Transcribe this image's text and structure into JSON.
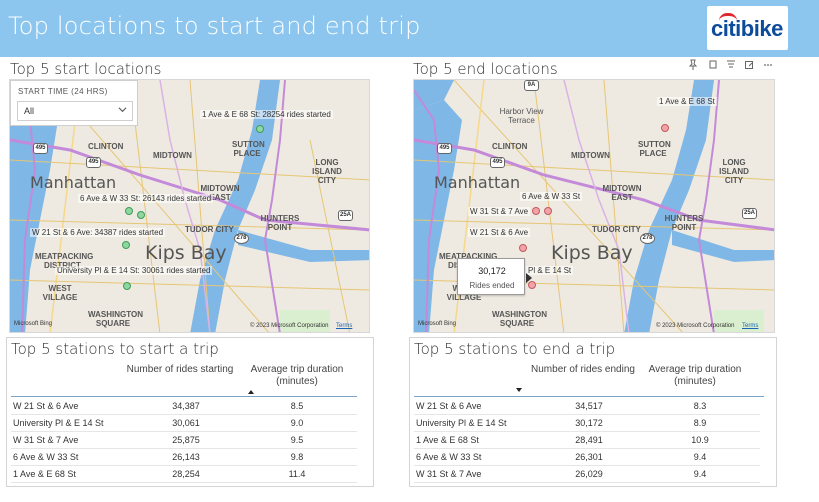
{
  "header": {
    "title": "Top locations to start and end trip",
    "logo_text_1": "citi",
    "logo_text_2": "bike",
    "background": "#8cc6ee",
    "logo_color": "#0d4b9b",
    "logo_arc_color": "#e0282f"
  },
  "start_map": {
    "title": "Top 5 start locations",
    "slicer": {
      "label": "START TIME (24 HRS)",
      "value": "All"
    },
    "labels": [
      "1 Ave & E 68 St: 28254 rides started",
      "6 Ave & W 33 St: 26143 rides started",
      "W 21 St & 6 Ave: 34387 rides started",
      "University Pl & E 14 St: 30061 rides started"
    ],
    "places": [
      "Manhattan",
      "Kips Bay",
      "CLINTON",
      "MIDTOWN",
      "SUTTON PLACE",
      "LONG ISLAND CITY",
      "MIDTOWN EAST",
      "HUNTERS POINT",
      "TUDOR CITY",
      "MEATPACKING DISTRICT",
      "WEST VILLAGE",
      "WASHINGTON SQUARE"
    ],
    "shields": [
      "495",
      "495",
      "25A",
      "278"
    ],
    "bing": "Microsoft Bing",
    "copyright": "© 2023 Microsoft Corporation",
    "terms": "Terms",
    "dot_color": "#8fd6a0"
  },
  "end_map": {
    "title": "Top 5 end locations",
    "labels": [
      "1 Ave & E 68 St",
      "6 Ave & W 33 St",
      "W 31 St & 7 Ave",
      "W 21 St & 6 Ave",
      "Pl & E 14 St"
    ],
    "places": [
      "Manhattan",
      "Kips Bay",
      "Harbor View Terrace",
      "CLINTON",
      "MIDTOWN",
      "SUTTON PLACE",
      "LONG ISLAND CITY",
      "MIDTOWN EAST",
      "HUNTERS POINT",
      "TUDOR CITY",
      "MEATPACKING DISTRICT",
      "WEST VILLAGE",
      "WASHINGTON SQUARE"
    ],
    "shields": [
      "9A",
      "495",
      "495",
      "25A",
      "278"
    ],
    "tooltip": {
      "value": "30,172",
      "label": "Rides ended"
    },
    "bing": "Microsoft Bing",
    "copyright": "© 2023 Microsoft Corporation",
    "terms": "Terms",
    "dot_color": "#f3a2a6",
    "icons": [
      "pin-icon",
      "copy-icon",
      "filter-icon",
      "focus-icon",
      "more-icon"
    ]
  },
  "start_table": {
    "title": "Top 5 stations to start a trip",
    "columns": [
      "Number of rides starting",
      "Average trip duration (minutes)"
    ],
    "rows": [
      [
        "W 21 St & 6 Ave",
        "34,387",
        "8.5"
      ],
      [
        "University Pl & E 14 St",
        "30,061",
        "9.0"
      ],
      [
        "W 31 St & 7 Ave",
        "25,875",
        "9.5"
      ],
      [
        "6 Ave & W 33 St",
        "26,143",
        "9.8"
      ],
      [
        "1 Ave & E 68 St",
        "28,254",
        "11.4"
      ]
    ]
  },
  "end_table": {
    "title": "Top 5 stations to end a trip",
    "columns": [
      "Number of rides ending",
      "Average trip duration (minutes)"
    ],
    "rows": [
      [
        "W 21 St & 6 Ave",
        "34,517",
        "8.3"
      ],
      [
        "University Pl & E 14 St",
        "30,172",
        "8.9"
      ],
      [
        "1 Ave & E 68 St",
        "28,491",
        "10.9"
      ],
      [
        "6 Ave & W 33 St",
        "26,301",
        "9.4"
      ],
      [
        "W 31 St & 7 Ave",
        "26,029",
        "9.4"
      ]
    ]
  }
}
